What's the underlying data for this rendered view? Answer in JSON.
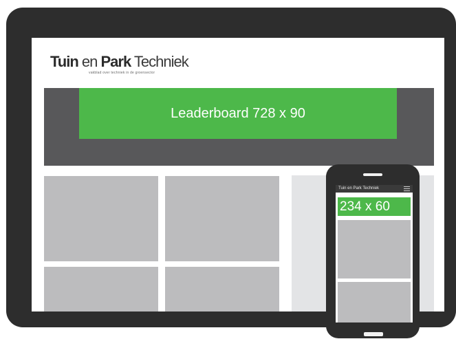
{
  "logo": {
    "part1": "Tuin",
    "part2": " en ",
    "part3": "Park",
    "part4": " Techniek",
    "tagline": "vakblad over techniek in de groensector"
  },
  "ads": {
    "leaderboard_label": "Leaderboard 728 x 90",
    "mobile_label": "234 x 60"
  },
  "phone": {
    "logo_text": "Tuin en Park Techniek",
    "menu_icon": "hamburger-menu-icon"
  },
  "colors": {
    "device_frame": "#2d2d2d",
    "header_band": "#58585a",
    "ad_green": "#4db84a",
    "tile_gray": "#bcbcbe",
    "sidebar_gray": "#e3e4e6"
  }
}
